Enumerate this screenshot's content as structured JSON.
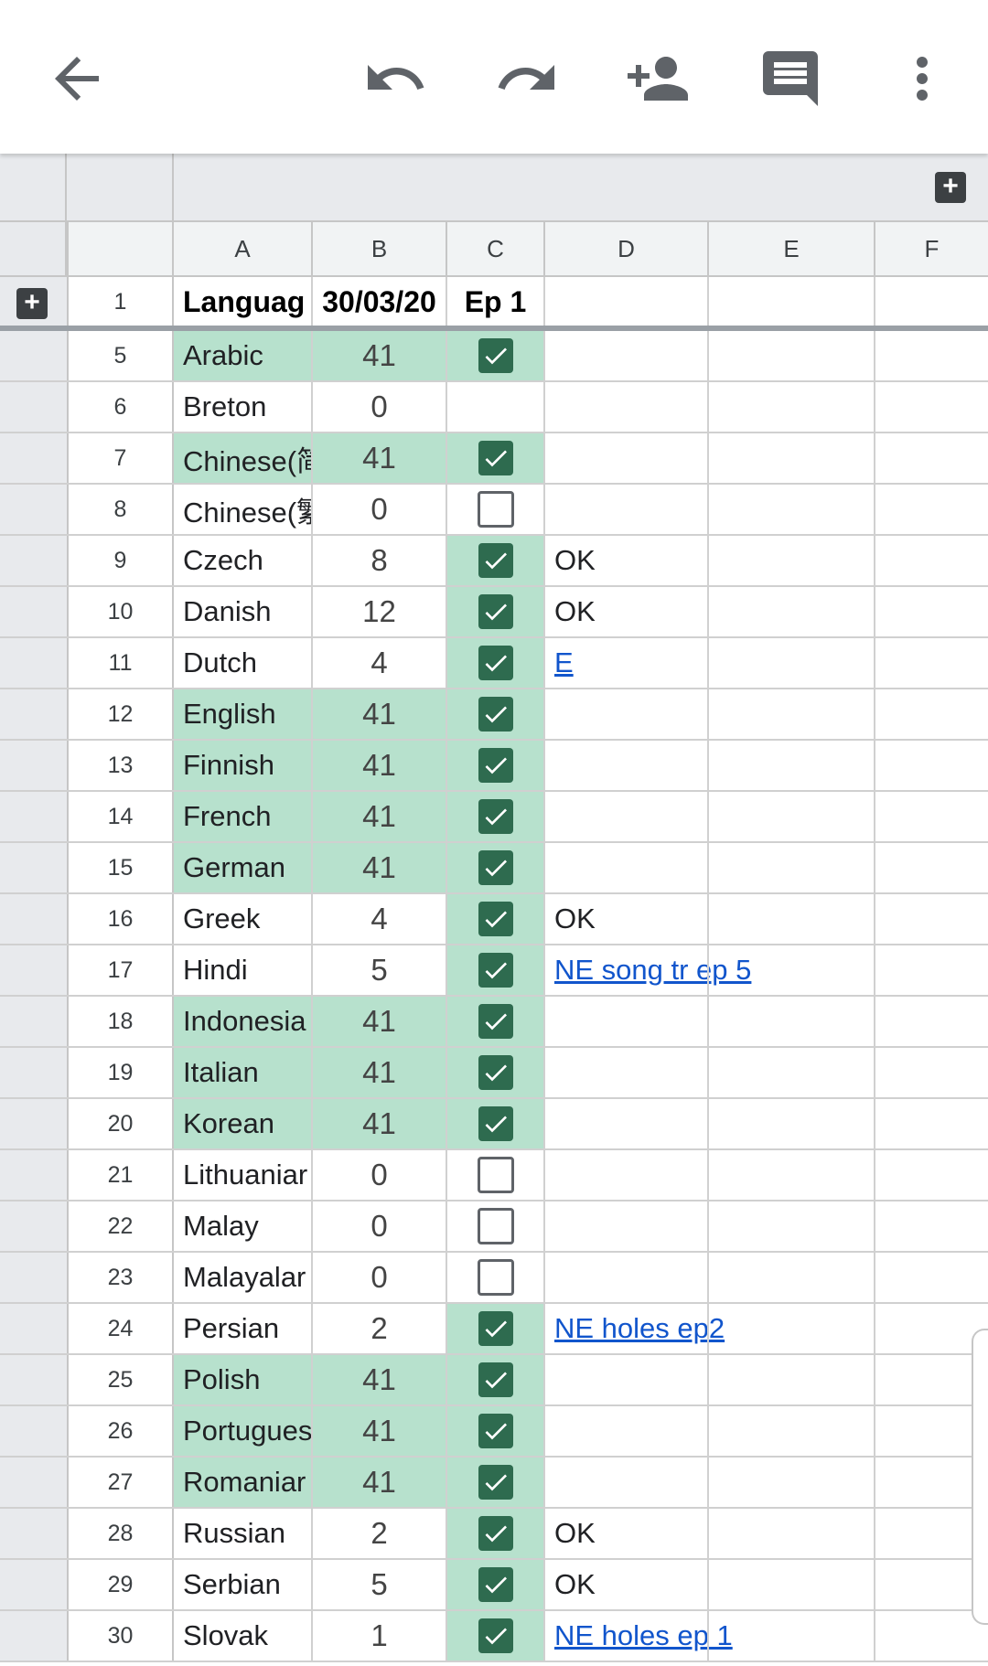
{
  "toolbar": {
    "icons": [
      "back-arrow-icon",
      "undo-icon",
      "redo-icon",
      "add-person-icon",
      "comment-icon",
      "more-vert-icon"
    ]
  },
  "columns": [
    "A",
    "B",
    "C",
    "D",
    "E",
    "F"
  ],
  "header_row": {
    "num": "1",
    "a": "Languag",
    "b": "30/03/20",
    "c": "Ep 1"
  },
  "rows": [
    {
      "num": "5",
      "a": "Arabic",
      "b": "41",
      "checked": true,
      "green": true,
      "d": ""
    },
    {
      "num": "6",
      "a": "Breton",
      "b": "0",
      "checked": null,
      "green": false,
      "d": ""
    },
    {
      "num": "7",
      "a": "Chinese(简",
      "b": "41",
      "checked": true,
      "green": true,
      "d": ""
    },
    {
      "num": "8",
      "a": "Chinese(繁",
      "b": "0",
      "checked": false,
      "green": false,
      "d": ""
    },
    {
      "num": "9",
      "a": "Czech",
      "b": "8",
      "checked": true,
      "green": false,
      "d": "OK"
    },
    {
      "num": "10",
      "a": "Danish",
      "b": "12",
      "checked": true,
      "green": false,
      "d": "OK"
    },
    {
      "num": "11",
      "a": "Dutch",
      "b": "4",
      "checked": true,
      "green": false,
      "d": "E",
      "d_link": true
    },
    {
      "num": "12",
      "a": "English",
      "b": "41",
      "checked": true,
      "green": true,
      "d": ""
    },
    {
      "num": "13",
      "a": "Finnish",
      "b": "41",
      "checked": true,
      "green": true,
      "d": ""
    },
    {
      "num": "14",
      "a": "French",
      "b": "41",
      "checked": true,
      "green": true,
      "d": ""
    },
    {
      "num": "15",
      "a": "German",
      "b": "41",
      "checked": true,
      "green": true,
      "d": ""
    },
    {
      "num": "16",
      "a": "Greek",
      "b": "4",
      "checked": true,
      "green": false,
      "d": "OK"
    },
    {
      "num": "17",
      "a": "Hindi",
      "b": "5",
      "checked": true,
      "green": false,
      "d": "NE song tr ep 5",
      "d_link": true
    },
    {
      "num": "18",
      "a": "Indonesia",
      "b": "41",
      "checked": true,
      "green": true,
      "d": ""
    },
    {
      "num": "19",
      "a": "Italian",
      "b": "41",
      "checked": true,
      "green": true,
      "d": ""
    },
    {
      "num": "20",
      "a": "Korean",
      "b": "41",
      "checked": true,
      "green": true,
      "d": ""
    },
    {
      "num": "21",
      "a": "Lithuaniar",
      "b": "0",
      "checked": false,
      "green": false,
      "d": ""
    },
    {
      "num": "22",
      "a": "Malay",
      "b": "0",
      "checked": false,
      "green": false,
      "d": ""
    },
    {
      "num": "23",
      "a": "Malayalar",
      "b": "0",
      "checked": false,
      "green": false,
      "d": ""
    },
    {
      "num": "24",
      "a": "Persian",
      "b": "2",
      "checked": true,
      "green": false,
      "d": "NE holes ep2",
      "d_link": true
    },
    {
      "num": "25",
      "a": "Polish",
      "b": "41",
      "checked": true,
      "green": true,
      "d": ""
    },
    {
      "num": "26",
      "a": "Portugues",
      "b": "41",
      "checked": true,
      "green": true,
      "d": ""
    },
    {
      "num": "27",
      "a": "Romaniar",
      "b": "41",
      "checked": true,
      "green": true,
      "d": ""
    },
    {
      "num": "28",
      "a": "Russian",
      "b": "2",
      "checked": true,
      "green": false,
      "d": "OK"
    },
    {
      "num": "29",
      "a": "Serbian",
      "b": "5",
      "checked": true,
      "green": false,
      "d": "OK"
    },
    {
      "num": "30",
      "a": "Slovak",
      "b": "1",
      "checked": true,
      "green": false,
      "d": "NE holes ep 1",
      "d_link": true
    }
  ],
  "colors": {
    "highlight": "#b7e1cd",
    "checkbox_on": "#2e6b4f",
    "link": "#1155cc"
  }
}
